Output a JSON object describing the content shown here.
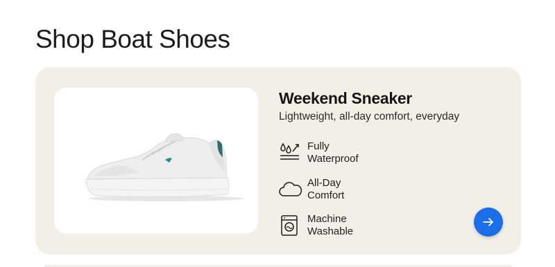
{
  "page": {
    "title": "Shop Boat Shoes"
  },
  "product": {
    "name": "Weekend Sneaker",
    "description": "Lightweight, all-day comfort, everyday",
    "image_alt": "white knit sneaker",
    "features": [
      {
        "icon": "water-drops-icon",
        "line1": "Fully",
        "line2": "Waterproof"
      },
      {
        "icon": "cloud-icon",
        "line1": "All-Day",
        "line2": "Comfort"
      },
      {
        "icon": "washing-machine-icon",
        "line1": "Machine",
        "line2": "Washable"
      }
    ]
  },
  "actions": {
    "next_icon": "arrow-right-icon"
  },
  "colors": {
    "card_background": "#f2efe7",
    "accent": "#1a6ee8",
    "text": "#1a1a1a"
  }
}
